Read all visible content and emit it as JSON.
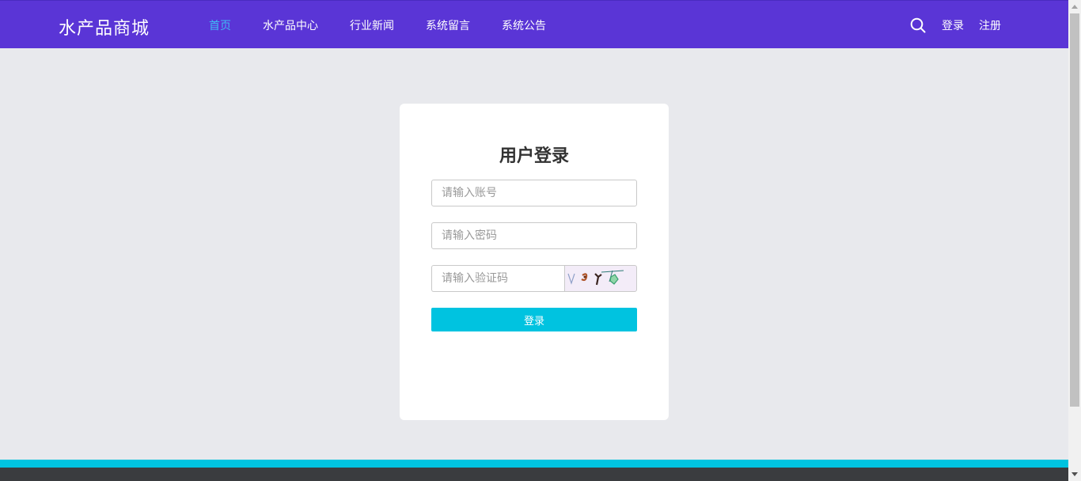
{
  "header": {
    "logo": "水产品商城",
    "nav": [
      {
        "label": "首页",
        "active": true
      },
      {
        "label": "水产品中心",
        "active": false
      },
      {
        "label": "行业新闻",
        "active": false
      },
      {
        "label": "系统留言",
        "active": false
      },
      {
        "label": "系统公告",
        "active": false
      }
    ],
    "login_label": "登录",
    "register_label": "注册",
    "search_icon": "search-icon"
  },
  "login": {
    "title": "用户登录",
    "account_placeholder": "请输入账号",
    "account_value": "",
    "password_placeholder": "请输入密码",
    "password_value": "",
    "captcha_placeholder": "请输入验证码",
    "captcha_value": "",
    "submit_label": "登录"
  },
  "colors": {
    "header_bg": "#5a35d6",
    "nav_active": "#3dbdf5",
    "button_bg": "#00c3e0",
    "page_bg": "#e8e9ed",
    "footer_bg": "#3a3c3f"
  }
}
